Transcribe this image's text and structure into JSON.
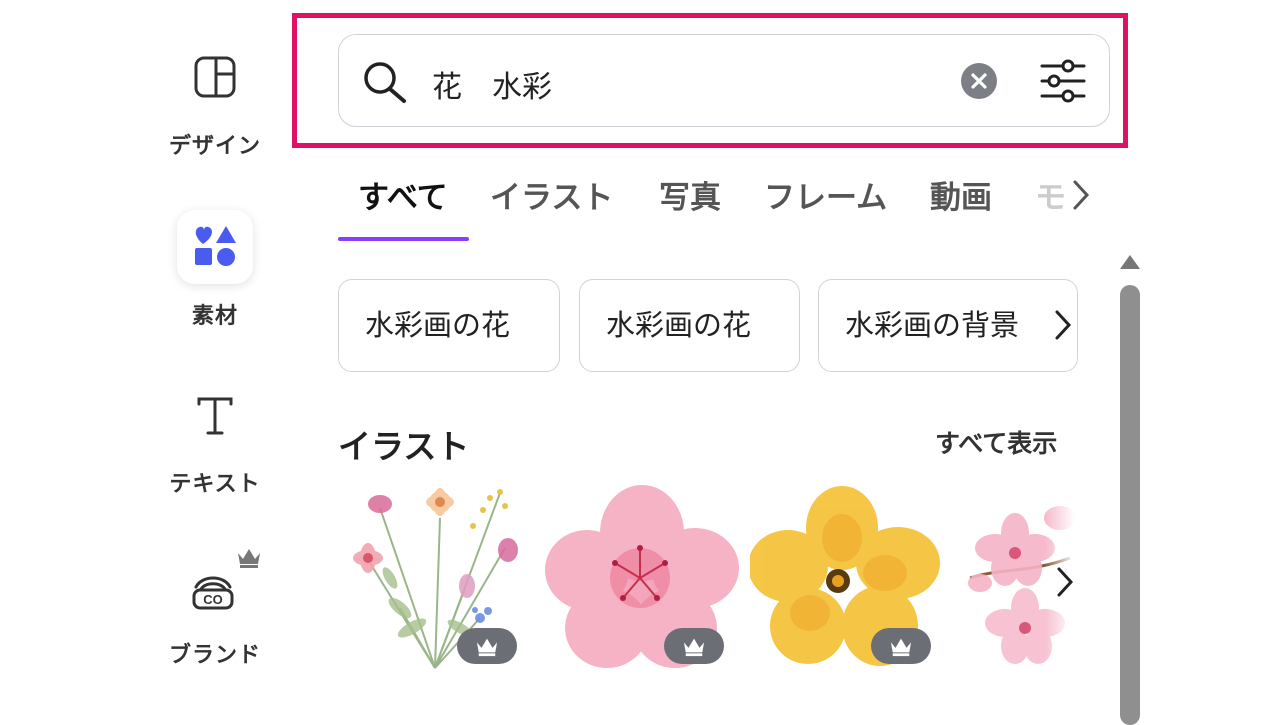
{
  "sidebar": {
    "items": [
      {
        "label": "デザイン",
        "icon": "layout-icon"
      },
      {
        "label": "素材",
        "icon": "shapes-icon",
        "active": true
      },
      {
        "label": "テキスト",
        "icon": "text-icon"
      },
      {
        "label": "ブランド",
        "icon": "brand-icon",
        "premium": true
      }
    ]
  },
  "search": {
    "value": "花　水彩",
    "icons": [
      "search-icon",
      "clear-icon",
      "filter-icon"
    ]
  },
  "tabs": [
    {
      "label": "すべて",
      "active": true
    },
    {
      "label": "イラスト"
    },
    {
      "label": "写真"
    },
    {
      "label": "フレーム"
    },
    {
      "label": "動画"
    },
    {
      "label": "モ"
    }
  ],
  "chips": [
    "水彩画の花",
    "水彩画の花",
    "水彩画の背景"
  ],
  "section": {
    "title": "イラスト",
    "see_all": "すべて表示"
  },
  "thumbnails": [
    {
      "subject": "wildflower-bouquet",
      "premium": true
    },
    {
      "subject": "pink-flower",
      "premium": true
    },
    {
      "subject": "yellow-flower",
      "premium": true
    },
    {
      "subject": "cherry-blossom",
      "premium": false
    }
  ],
  "colors": {
    "highlight": "#dd1166",
    "accent": "#8b3dff",
    "icon_blue": "#4a5bf0"
  }
}
